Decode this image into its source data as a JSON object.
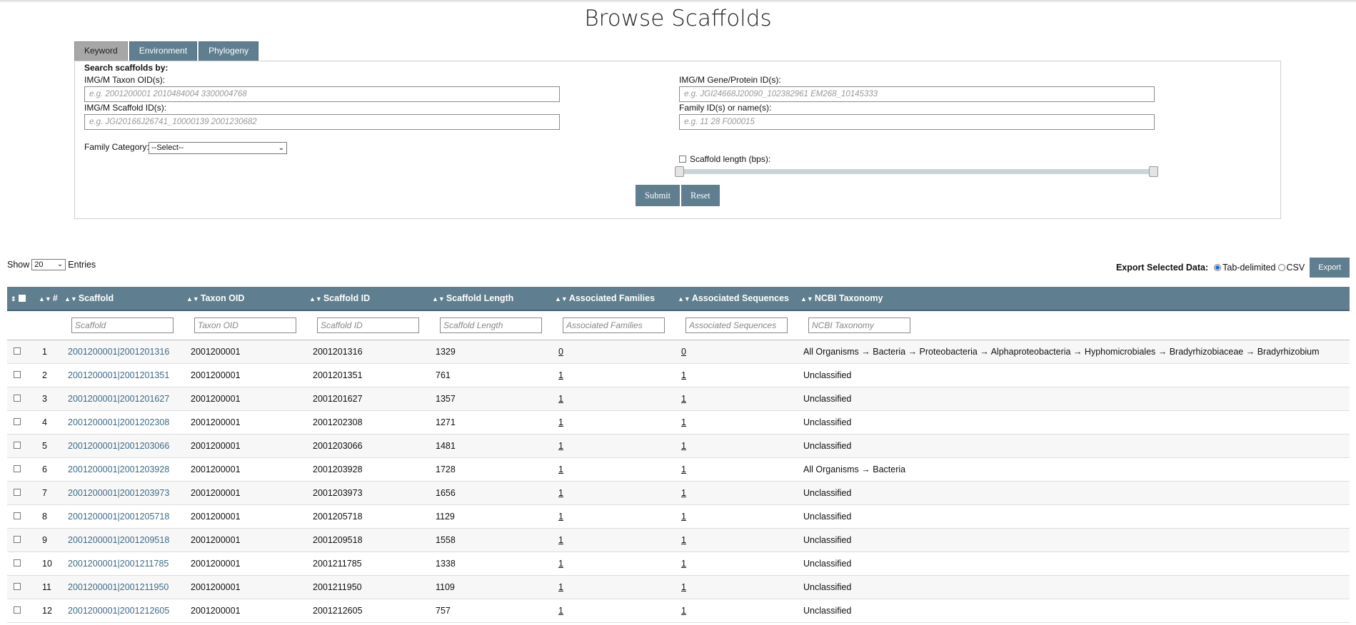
{
  "page": {
    "title": "Browse Scaffolds"
  },
  "tabs": [
    "Keyword",
    "Environment",
    "Phylogeny"
  ],
  "search": {
    "heading": "Search scaffolds by:",
    "taxon_label": "IMG/M Taxon OID(s):",
    "taxon_placeholder": "e.g. 2001200001 2010484004 3300004768",
    "scaffold_label": "IMG/M Scaffold ID(s):",
    "scaffold_placeholder": "e.g. JGI20166J26741_10000139 2001230682",
    "gene_label": "IMG/M Gene/Protein ID(s):",
    "gene_placeholder": "e.g. JGI24668J20090_102382961 EM268_10145333",
    "family_label": "Family ID(s) or name(s):",
    "family_placeholder": "e.g. 11 28 F000015",
    "family_category_label": "Family Category:",
    "family_category_value": "--Select--",
    "length_label": "Scaffold length (bps):",
    "submit": "Submit",
    "reset": "Reset"
  },
  "entries": {
    "show": "Show",
    "value": "20",
    "suffix": "Entries"
  },
  "export": {
    "label": "Export Selected Data:",
    "opt1": "Tab-delimited",
    "opt2": "CSV",
    "button": "Export"
  },
  "table": {
    "headers": [
      "#",
      "Scaffold",
      "Taxon OID",
      "Scaffold ID",
      "Scaffold Length",
      "Associated Families",
      "Associated Sequences",
      "NCBI Taxonomy"
    ],
    "filters": [
      "Scaffold",
      "Taxon OID",
      "Scaffold ID",
      "Scaffold Length",
      "Associated Families",
      "Associated Sequences",
      "NCBI Taxonomy"
    ],
    "rows": [
      {
        "n": "1",
        "scaffold": "2001200001|2001201316",
        "taxon": "2001200001",
        "sid": "2001201316",
        "len": "1329",
        "fam": "0",
        "seq": "0",
        "tax": "All Organisms → Bacteria → Proteobacteria → Alphaproteobacteria → Hyphomicrobiales → Bradyrhizobiaceae → Bradyrhizobium"
      },
      {
        "n": "2",
        "scaffold": "2001200001|2001201351",
        "taxon": "2001200001",
        "sid": "2001201351",
        "len": "761",
        "fam": "1",
        "seq": "1",
        "tax": "Unclassified"
      },
      {
        "n": "3",
        "scaffold": "2001200001|2001201627",
        "taxon": "2001200001",
        "sid": "2001201627",
        "len": "1357",
        "fam": "1",
        "seq": "1",
        "tax": "Unclassified"
      },
      {
        "n": "4",
        "scaffold": "2001200001|2001202308",
        "taxon": "2001200001",
        "sid": "2001202308",
        "len": "1271",
        "fam": "1",
        "seq": "1",
        "tax": "Unclassified"
      },
      {
        "n": "5",
        "scaffold": "2001200001|2001203066",
        "taxon": "2001200001",
        "sid": "2001203066",
        "len": "1481",
        "fam": "1",
        "seq": "1",
        "tax": "Unclassified"
      },
      {
        "n": "6",
        "scaffold": "2001200001|2001203928",
        "taxon": "2001200001",
        "sid": "2001203928",
        "len": "1728",
        "fam": "1",
        "seq": "1",
        "tax": "All Organisms → Bacteria"
      },
      {
        "n": "7",
        "scaffold": "2001200001|2001203973",
        "taxon": "2001200001",
        "sid": "2001203973",
        "len": "1656",
        "fam": "1",
        "seq": "1",
        "tax": "Unclassified"
      },
      {
        "n": "8",
        "scaffold": "2001200001|2001205718",
        "taxon": "2001200001",
        "sid": "2001205718",
        "len": "1129",
        "fam": "1",
        "seq": "1",
        "tax": "Unclassified"
      },
      {
        "n": "9",
        "scaffold": "2001200001|2001209518",
        "taxon": "2001200001",
        "sid": "2001209518",
        "len": "1558",
        "fam": "1",
        "seq": "1",
        "tax": "Unclassified"
      },
      {
        "n": "10",
        "scaffold": "2001200001|2001211785",
        "taxon": "2001200001",
        "sid": "2001211785",
        "len": "1338",
        "fam": "1",
        "seq": "1",
        "tax": "Unclassified"
      },
      {
        "n": "11",
        "scaffold": "2001200001|2001211950",
        "taxon": "2001200001",
        "sid": "2001211950",
        "len": "1109",
        "fam": "1",
        "seq": "1",
        "tax": "Unclassified"
      },
      {
        "n": "12",
        "scaffold": "2001200001|2001212605",
        "taxon": "2001200001",
        "sid": "2001212605",
        "len": "757",
        "fam": "1",
        "seq": "1",
        "tax": "Unclassified"
      }
    ]
  }
}
